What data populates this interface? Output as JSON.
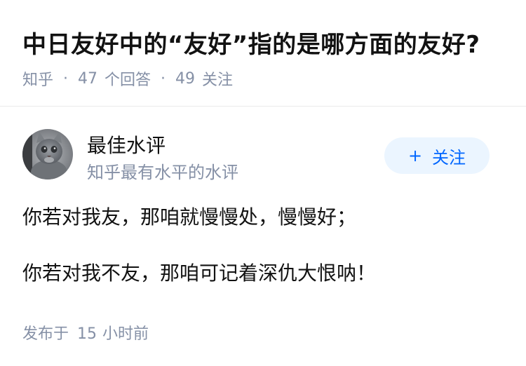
{
  "question": {
    "title": "中日友好中的“友好”指的是哪方面的友好?",
    "source": "知乎",
    "separator": "·",
    "answer_count": "47",
    "answer_label": "个回答",
    "follower_count": "49",
    "follower_label": "关注"
  },
  "author": {
    "name": "最佳水评",
    "bio": "知乎最有水平的水评",
    "follow_plus": "+",
    "follow_label": "关注",
    "avatar_icon": "cat-avatar"
  },
  "answer": {
    "paragraphs": [
      "你若对我友，那咱就慢慢处，慢慢好；",
      "你若对我不友，那咱可记着深仇大恨呐！"
    ],
    "time_prefix": "发布于",
    "time_value": "15",
    "time_unit": "小时前"
  },
  "colors": {
    "title": "#121212",
    "meta": "#8590a6",
    "accent": "#0066ff",
    "follow_bg": "#ebf5ff",
    "divider": "#ebebeb"
  }
}
